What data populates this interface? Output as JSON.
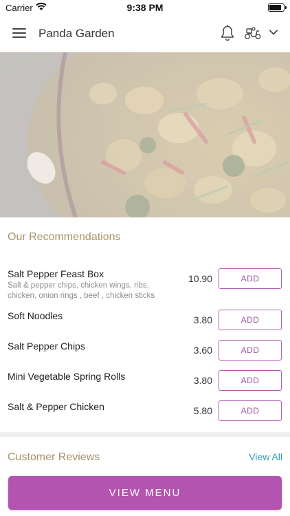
{
  "status_bar": {
    "carrier": "Carrier",
    "time": "9:38 PM",
    "battery_level": 0.95
  },
  "header": {
    "title": "Panda Garden",
    "icons": {
      "menu": "hamburger-menu-icon",
      "notifications": "bell-icon",
      "delivery": "scooter-icon",
      "dropdown": "chevron-down-icon"
    }
  },
  "hero": {
    "image": "stir-fry-chicken-dish-photo"
  },
  "recommendations": {
    "title": "Our Recommendations",
    "items": [
      {
        "name": "Salt Pepper Feast Box",
        "description": "Salt & pepper chips, chicken wings, ribs, chicken, onion rings , beef , chicken sticks",
        "price": "10.90",
        "add_label": "ADD"
      },
      {
        "name": "Soft Noodles",
        "description": "",
        "price": "3.80",
        "add_label": "ADD"
      },
      {
        "name": "Salt Pepper Chips",
        "description": "",
        "price": "3.60",
        "add_label": "ADD"
      },
      {
        "name": "Mini Vegetable Spring Rolls",
        "description": "",
        "price": "3.80",
        "add_label": "ADD"
      },
      {
        "name": "Salt & Pepper Chicken",
        "description": "",
        "price": "5.80",
        "add_label": "ADD"
      }
    ]
  },
  "reviews": {
    "title": "Customer Reviews",
    "view_all_label": "View All"
  },
  "footer": {
    "view_menu_label": "VIEW MENU"
  },
  "colors": {
    "accent": "#b354b1",
    "section_title": "#a89266",
    "link": "#2a9bb5"
  }
}
